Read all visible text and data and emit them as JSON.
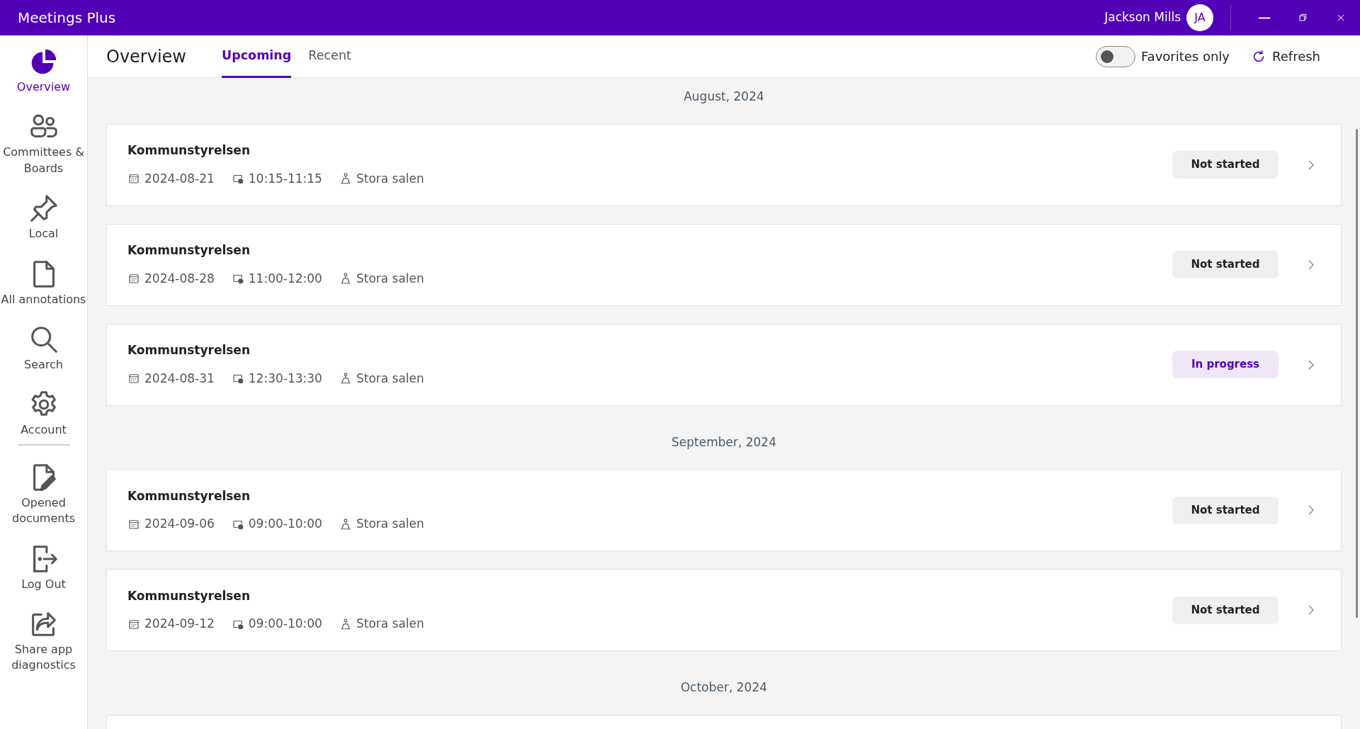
{
  "window": {
    "title": "Meetings Plus",
    "user": "Jackson Mills",
    "initials": "JA"
  },
  "sidebar": {
    "items": [
      {
        "label": "Overview",
        "selected": true
      },
      {
        "label": "Committees & Boards",
        "selected": false
      },
      {
        "label": "Local",
        "selected": false
      },
      {
        "label": "All annotations",
        "selected": false
      },
      {
        "label": "Search",
        "selected": false
      },
      {
        "label": "Account",
        "selected": false
      }
    ],
    "bottom_items": [
      {
        "label": "Opened documents",
        "selected": false
      },
      {
        "label": "Log Out",
        "selected": false
      },
      {
        "label": "Share app diagnostics",
        "selected": false
      }
    ]
  },
  "header": {
    "title": "Overview",
    "tabs": [
      {
        "label": "Upcoming",
        "selected": true
      },
      {
        "label": "Recent",
        "selected": false
      }
    ],
    "toggle": {
      "label": "Favorites only",
      "on": false
    },
    "refresh": "Refresh"
  },
  "groups": [
    {
      "month": "August, 2024",
      "meetings": [
        {
          "title": "Kommunstyrelsen",
          "date": "2024-08-21",
          "time": "10:15-11:15",
          "place": "Stora salen",
          "status": "Not started",
          "kind": "not_started"
        },
        {
          "title": "Kommunstyrelsen",
          "date": "2024-08-28",
          "time": "11:00-12:00",
          "place": "Stora salen",
          "status": "Not started",
          "kind": "not_started"
        },
        {
          "title": "Kommunstyrelsen",
          "date": "2024-08-31",
          "time": "12:30-13:30",
          "place": "Stora salen",
          "status": "In progress",
          "kind": "in_progress"
        }
      ]
    },
    {
      "month": "September, 2024",
      "meetings": [
        {
          "title": "Kommunstyrelsen",
          "date": "2024-09-06",
          "time": "09:00-10:00",
          "place": "Stora salen",
          "status": "Not started",
          "kind": "not_started"
        },
        {
          "title": "Kommunstyrelsen",
          "date": "2024-09-12",
          "time": "09:00-10:00",
          "place": "Stora salen",
          "status": "Not started",
          "kind": "not_started"
        }
      ]
    },
    {
      "month": "October, 2024"
    }
  ]
}
